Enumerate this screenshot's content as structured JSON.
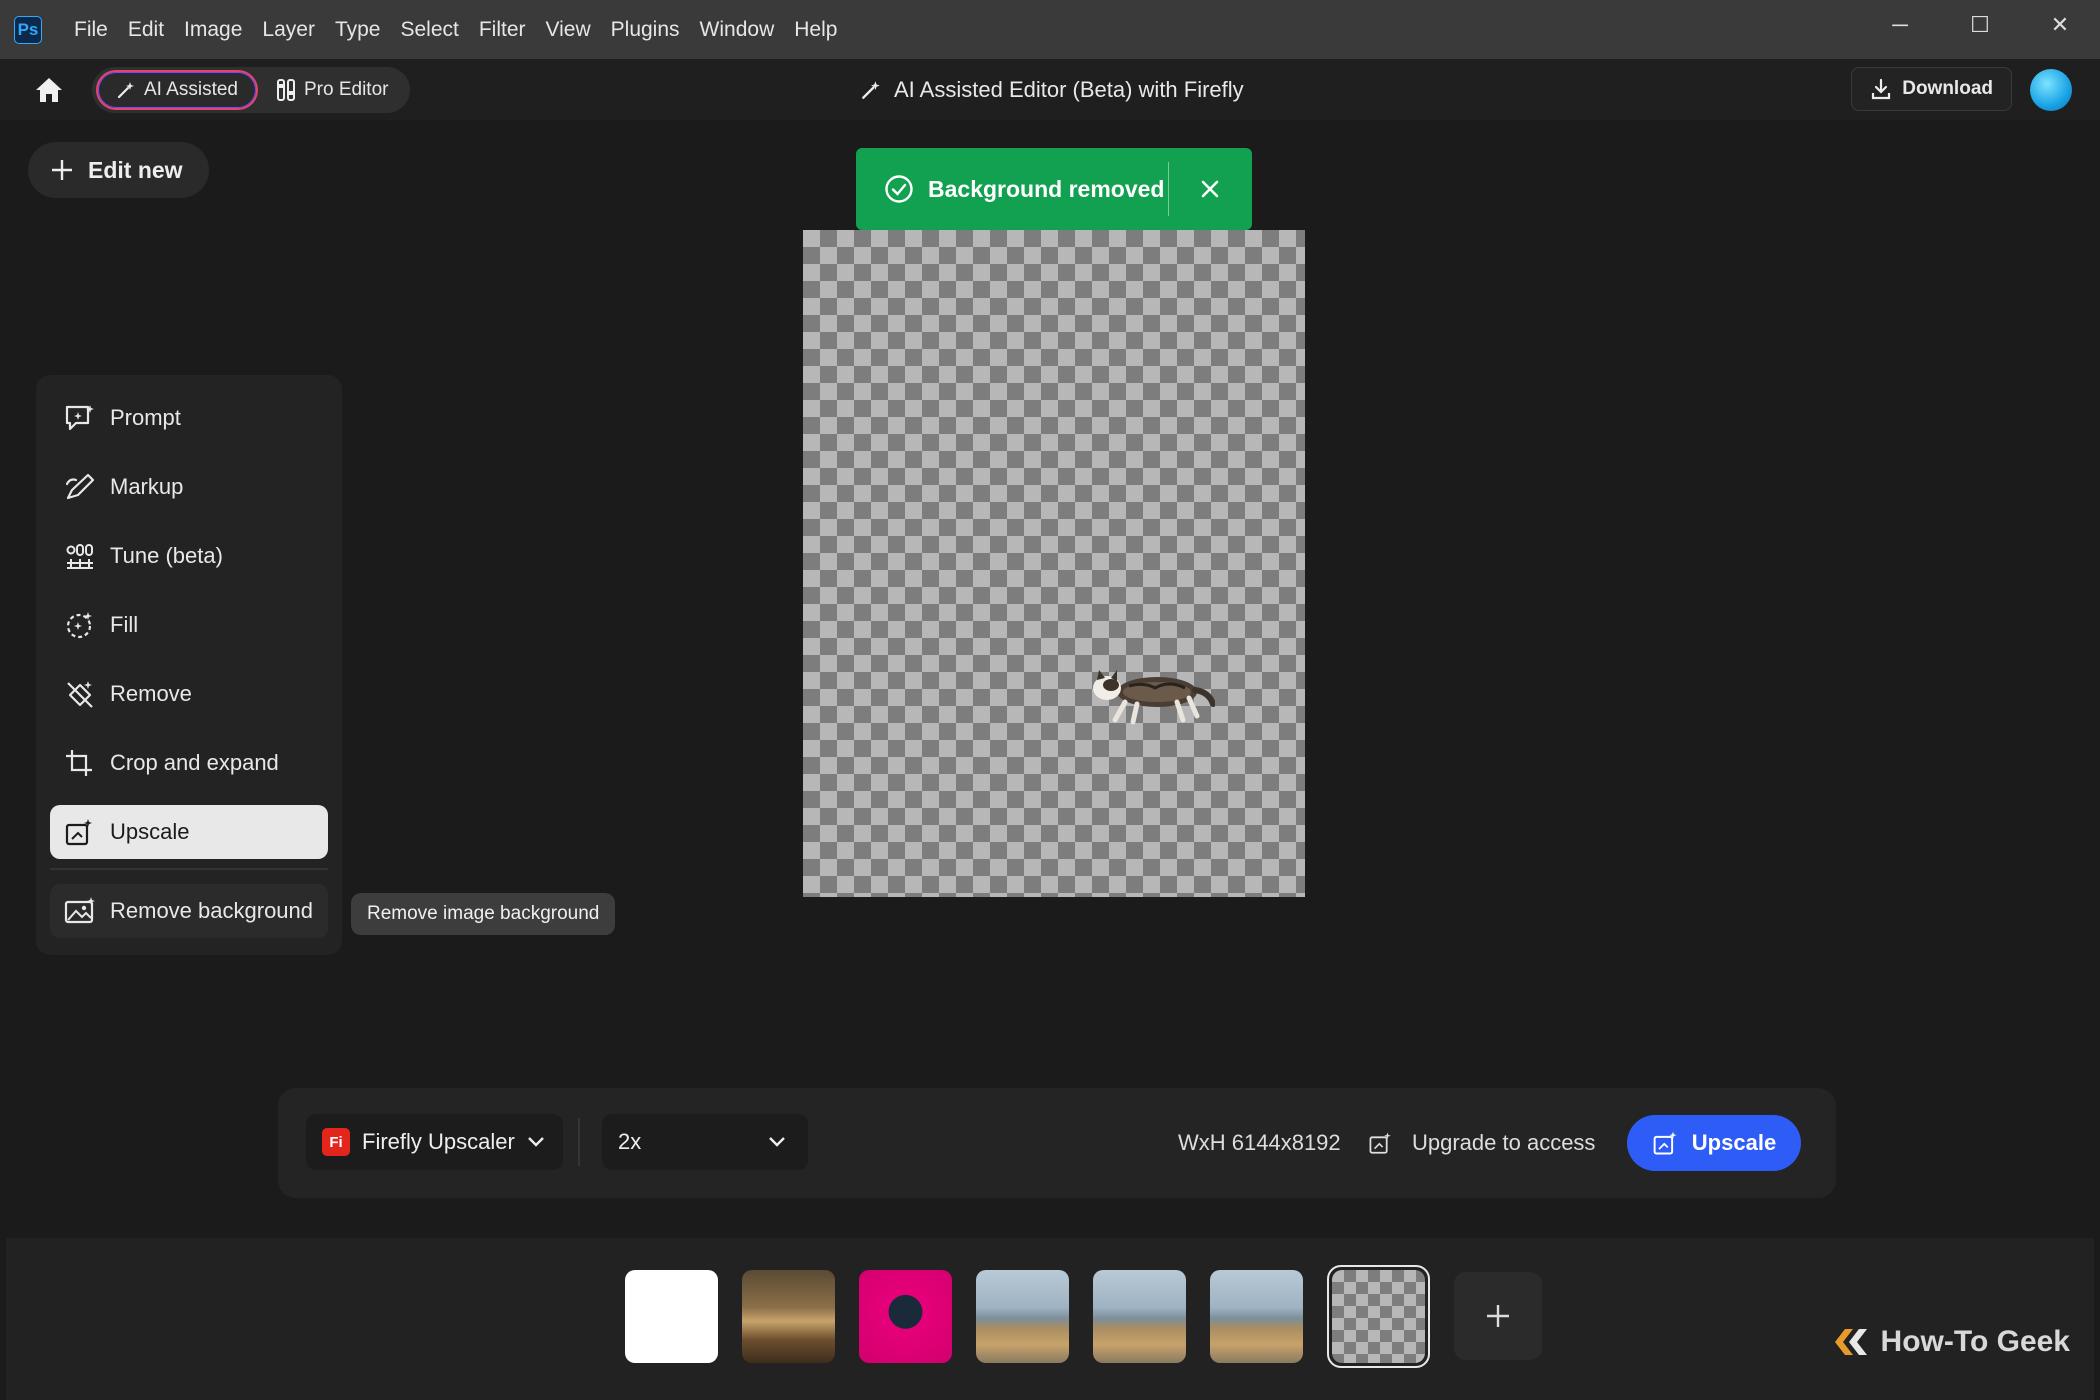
{
  "menu": {
    "app_icon_label": "Ps",
    "items": [
      "File",
      "Edit",
      "Image",
      "Layer",
      "Type",
      "Select",
      "Filter",
      "View",
      "Plugins",
      "Window",
      "Help"
    ]
  },
  "window_controls": {
    "minimize": "─",
    "maximize": "☐",
    "close": "✕"
  },
  "appbar": {
    "modes": [
      {
        "label": "AI Assisted",
        "active": true
      },
      {
        "label": "Pro Editor",
        "active": false
      }
    ],
    "title": "AI Assisted Editor (Beta) with Firefly",
    "download_label": "Download"
  },
  "workspace": {
    "edit_new_label": "Edit new",
    "toast": {
      "message": "Background removed",
      "status_color": "#12a150"
    },
    "tools": [
      {
        "label": "Prompt",
        "icon": "prompt-icon"
      },
      {
        "label": "Markup",
        "icon": "markup-icon"
      },
      {
        "label": "Tune (beta)",
        "icon": "tune-icon"
      },
      {
        "label": "Fill",
        "icon": "fill-icon"
      },
      {
        "label": "Remove",
        "icon": "remove-icon"
      },
      {
        "label": "Crop and expand",
        "icon": "crop-icon"
      },
      {
        "label": "Upscale",
        "icon": "upscale-icon",
        "selected": true
      },
      {
        "label": "Remove background",
        "icon": "remove-background-icon"
      }
    ],
    "tooltip": "Remove image background"
  },
  "options_bar": {
    "model_logo": "Fi",
    "model_label": "Firefly Upscaler",
    "scale_value": "2x",
    "dimensions": "WxH 6144x8192",
    "upgrade_label": "Upgrade to access",
    "upscale_button": "Upscale",
    "accent_color": "#2d5cf6"
  },
  "filmstrip": {
    "add_label": "+"
  },
  "watermark": "How-To Geek"
}
